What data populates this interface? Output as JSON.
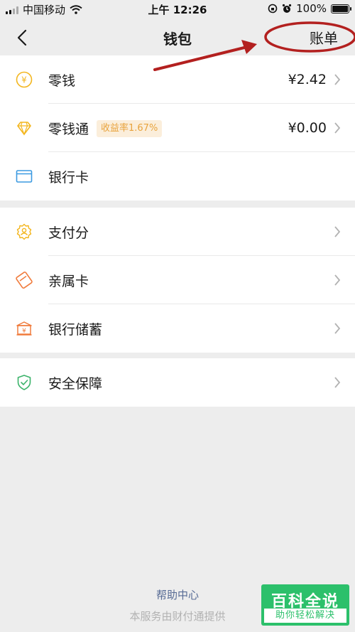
{
  "status_bar": {
    "carrier": "中国移动",
    "time": "上午 12:26",
    "battery": "100%"
  },
  "nav": {
    "title": "钱包",
    "bill_label": "账单"
  },
  "sections": [
    {
      "rows": [
        {
          "label": "零钱",
          "value": "¥2.42",
          "icon": "yuan-coin-icon"
        },
        {
          "label": "零钱通",
          "badge": "收益率1.67%",
          "value": "¥0.00",
          "icon": "diamond-icon"
        },
        {
          "label": "银行卡",
          "icon": "bank-card-icon"
        }
      ]
    },
    {
      "rows": [
        {
          "label": "支付分",
          "icon": "pay-score-icon"
        },
        {
          "label": "亲属卡",
          "icon": "family-card-icon"
        },
        {
          "label": "银行储蓄",
          "icon": "bank-savings-icon"
        }
      ]
    },
    {
      "rows": [
        {
          "label": "安全保障",
          "icon": "shield-check-icon"
        }
      ]
    }
  ],
  "footer": {
    "help_link": "帮助中心",
    "provider_note": "本服务由财付通提供"
  },
  "watermark": {
    "title": "百科全说",
    "subtitle": "助你轻松解决"
  },
  "colors": {
    "background": "#ededed",
    "link": "#576b95",
    "annotation": "#b3201f",
    "coin": "#f3b61f",
    "card": "#3b9ae1",
    "family": "#f07b3c",
    "shield": "#3bb36a",
    "badge_text": "#e8a33d"
  }
}
